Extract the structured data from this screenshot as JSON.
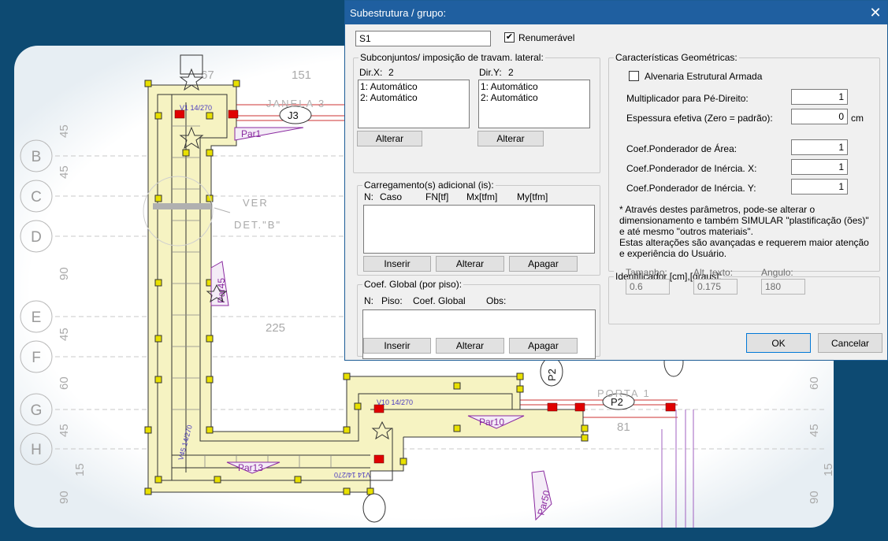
{
  "cad": {
    "dims": [
      "67",
      "151",
      "225",
      "81"
    ],
    "row_dims": [
      "45",
      "45",
      "90",
      "45",
      "60",
      "45",
      "15",
      "90"
    ],
    "right_dims": [
      "60",
      "45",
      "15",
      "90"
    ],
    "grid_rows": [
      "B",
      "C",
      "D",
      "E",
      "F",
      "G",
      "H"
    ],
    "labels": {
      "janela": "JANELA 3",
      "ver": "VER",
      "det": "DET.\"B\"",
      "porta": "PORTA 1",
      "par1": "Par1",
      "par45": "Par45",
      "par10": "Par10",
      "par13": "Par13",
      "par50": "Par50",
      "p2a": "P2",
      "p2b": "P2",
      "j3": "J3",
      "v1": "V1 14/270",
      "v10": "V10 14/270",
      "v45": "V45 14/270",
      "v14": "V14 14/270"
    },
    "colors": {
      "wall_fill": "#f6f3c2",
      "wall_stroke": "#333333",
      "node": "#e8e000",
      "support": "#e00000",
      "beam": "#cc2222",
      "column": "#8a2aa0"
    }
  },
  "dialog": {
    "title": "Subestrutura / grupo:",
    "name_value": "S1",
    "renumeravel_label": "Renumerável",
    "renumeravel_checked": "✔",
    "subconj": {
      "legend": "Subconjuntos/ imposição de travam. lateral:",
      "dirx_label": "Dir.X:",
      "dirx_count": "2",
      "diry_label": "Dir.Y:",
      "diry_count": "2",
      "dirx_items": [
        "1: Automático",
        "2: Automático"
      ],
      "diry_items": [
        "1: Automático",
        "2: Automático"
      ],
      "alterar_x": "Alterar",
      "alterar_y": "Alterar"
    },
    "carreg": {
      "legend": "Carregamento(s) adicional (is):",
      "col_n": "N:",
      "col_caso": "Caso",
      "col_fn": "FN[tf]",
      "col_mx": "Mx[tfm]",
      "col_my": "My[tfm]",
      "inserir": "Inserir",
      "alterar": "Alterar",
      "apagar": "Apagar"
    },
    "coef": {
      "legend": "Coef. Global (por piso):",
      "col_n": "N:",
      "col_piso": "Piso:",
      "col_coef": "Coef. Global",
      "col_obs": "Obs:",
      "inserir": "Inserir",
      "alterar": "Alterar",
      "apagar": "Apagar"
    },
    "geom": {
      "legend": "Características Geométricas:",
      "alvenaria_label": "Alvenaria Estrutural Armada",
      "mult_label": "Multiplicador para Pé-Direito:",
      "mult_value": "1",
      "espessura_label": "Espessura efetiva (Zero = padrão):",
      "espessura_value": "0",
      "espessura_unit": "cm",
      "area_label": "Coef.Ponderador de Área:",
      "area_value": "1",
      "inerx_label": "Coef.Ponderador de Inércia. X:",
      "inerx_value": "1",
      "inery_label": "Coef.Ponderador de Inércia. Y:",
      "inery_value": "1",
      "info_lines": [
        "* Através destes parâmetros,  pode-se alterar o",
        "dimensionamento e também SIMULAR \"plastificação (ões)\"",
        "e até mesmo \"outros materiais\".",
        "  Estas alterações são avançadas e requerem maior atenção",
        "e experiência do Usuário."
      ]
    },
    "ident": {
      "legend": "Identificador [cm],[graus]:",
      "tamanho_label": "Tamanho:",
      "tamanho_value": "0.6",
      "alt_label": "Alt. texto:",
      "alt_value": "0.175",
      "angulo_label": "Angulo:",
      "angulo_value": "180"
    },
    "ok": "OK",
    "cancel": "Cancelar"
  }
}
